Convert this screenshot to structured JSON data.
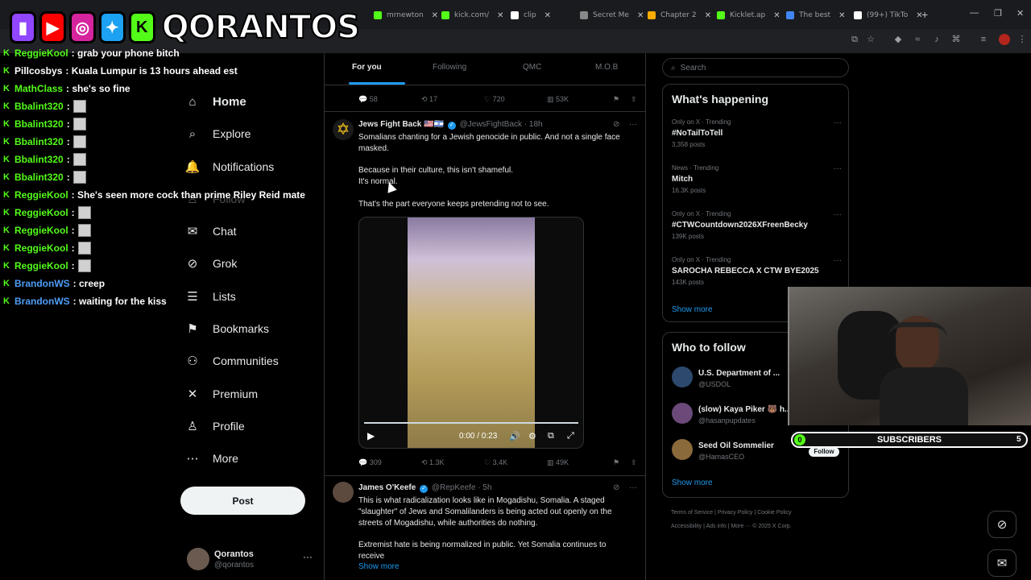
{
  "browser": {
    "tabs": [
      {
        "label": "mrnewton",
        "color": "#53fc18"
      },
      {
        "label": "kick.com/",
        "color": "#53fc18"
      },
      {
        "label": "clip",
        "color": "#ffffff"
      },
      {
        "label": "Secret Me",
        "color": "#888888"
      },
      {
        "label": "Chapter 2",
        "color": "#f9ab00"
      },
      {
        "label": "Kicklet.ap",
        "color": "#53fc18"
      },
      {
        "label": "The best",
        "color": "#4285f4"
      },
      {
        "label": "(99+) TikTo",
        "color": "#ffffff"
      }
    ]
  },
  "overlay": {
    "brand": "QORANTOS",
    "chat": [
      {
        "user": "ReggieKool",
        "color": "#53fc18",
        "text": ": grab your phone bitch",
        "emote": false
      },
      {
        "user": "Pillcosbys",
        "color": "#ffffff",
        "text": ": Kuala Lumpur is 13 hours ahead est",
        "emote": false
      },
      {
        "user": "MathClass",
        "color": "#53fc18",
        "text": ": she's so fine",
        "emote": false
      },
      {
        "user": "Bbalint320",
        "color": "#53fc18",
        "text": ":",
        "emote": true
      },
      {
        "user": "Bbalint320",
        "color": "#53fc18",
        "text": ":",
        "emote": true
      },
      {
        "user": "Bbalint320",
        "color": "#53fc18",
        "text": ":",
        "emote": true
      },
      {
        "user": "Bbalint320",
        "color": "#53fc18",
        "text": ":",
        "emote": true
      },
      {
        "user": "Bbalint320",
        "color": "#53fc18",
        "text": ":",
        "emote": true
      },
      {
        "user": "ReggieKool",
        "color": "#53fc18",
        "text": ": She's seen more cock than prime Riley Reid mate",
        "emote": false
      },
      {
        "user": "ReggieKool",
        "color": "#53fc18",
        "text": ":",
        "emote": true
      },
      {
        "user": "ReggieKool",
        "color": "#53fc18",
        "text": ":",
        "emote": true
      },
      {
        "user": "ReggieKool",
        "color": "#53fc18",
        "text": ":",
        "emote": true
      },
      {
        "user": "ReggieKool",
        "color": "#53fc18",
        "text": ":",
        "emote": true
      },
      {
        "user": "BrandonWS",
        "color": "#4f9ef8",
        "text": ": creep",
        "emote": false
      },
      {
        "user": "BrandonWS",
        "color": "#4f9ef8",
        "text": ": waiting for the kiss",
        "emote": false
      }
    ],
    "subscribers": {
      "label": "SUBSCRIBERS",
      "current": "0",
      "goal": "5",
      "progress": 0
    }
  },
  "nav": {
    "items": [
      {
        "label": "Home",
        "icon": "home-icon",
        "glyph": "⌂"
      },
      {
        "label": "Explore",
        "icon": "search-icon",
        "glyph": "⌕"
      },
      {
        "label": "Notifications",
        "icon": "bell-icon",
        "glyph": "🔔"
      },
      {
        "label": "Follow",
        "icon": "follow-icon",
        "glyph": "♙"
      },
      {
        "label": "Chat",
        "icon": "mail-icon",
        "glyph": "✉"
      },
      {
        "label": "Grok",
        "icon": "grok-icon",
        "glyph": "⊘"
      },
      {
        "label": "Lists",
        "icon": "list-icon",
        "glyph": "☰"
      },
      {
        "label": "Bookmarks",
        "icon": "bookmark-icon",
        "glyph": "⚑"
      },
      {
        "label": "Communities",
        "icon": "communities-icon",
        "glyph": "⚇"
      },
      {
        "label": "Premium",
        "icon": "x-logo-icon",
        "glyph": "✕"
      },
      {
        "label": "Profile",
        "icon": "profile-icon",
        "glyph": "♙"
      },
      {
        "label": "More",
        "icon": "more-circle-icon",
        "glyph": "⋯"
      }
    ],
    "post_label": "Post",
    "profile": {
      "name": "Qorantos",
      "handle": "@qorantos"
    }
  },
  "feed": {
    "tabs": [
      "For you",
      "Following",
      "QMC",
      "M.O.B"
    ],
    "prev_actions": {
      "replies": "58",
      "reposts": "17",
      "likes": "720",
      "views": "53K"
    },
    "tweet1": {
      "name": "Jews Fight Back 🇺🇸🇮🇱",
      "handle": "@JewsFightBack",
      "time": "· 18h",
      "line1": "Somalians chanting for a Jewish genocide in public. And not a single face masked.",
      "line2": "Because in their culture, this isn't shameful.",
      "line3": "It's normal.",
      "line4": "That's the part everyone keeps pretending not to see.",
      "video_time": "0:00 / 0:23",
      "actions": {
        "replies": "309",
        "reposts": "1.3K",
        "likes": "3.4K",
        "views": "49K"
      }
    },
    "tweet2": {
      "name": "James O'Keefe",
      "handle": "@RepKeefe",
      "time": "· 5h",
      "line1": "This is what radicalization looks like in Mogadishu, Somalia. A staged \"slaughter\" of Jews and Somalilanders is being acted out openly on the streets of Mogadishu, while authorities do nothing.",
      "line2": "Extremist hate is being normalized in public. Yet Somalia continues to receive",
      "show_more": "Show more"
    }
  },
  "sidebar": {
    "search_placeholder": "Search",
    "happening_title": "What's happening",
    "trends": [
      {
        "context": "Only on X · Trending",
        "name": "#NoTailToTell",
        "count": "3,358 posts"
      },
      {
        "context": "News · Trending",
        "name": "Mitch",
        "count": "16.3K posts"
      },
      {
        "context": "Only on X · Trending",
        "name": "#CTWCountdown2026XFreenBecky",
        "count": "139K posts"
      },
      {
        "context": "Only on X · Trending",
        "name": "SAROCHA REBECCA X CTW BYE2025",
        "count": "143K posts"
      }
    ],
    "show_more": "Show more",
    "wtf_title": "Who to follow",
    "wtf": [
      {
        "name": "U.S. Department of ...",
        "handle": "@USDOL"
      },
      {
        "name": "(slow) Kaya Piker 🐻 h...",
        "handle": "@hasanpupdates"
      },
      {
        "name": "Seed Oil Sommelier",
        "handle": "@HamasCEO"
      }
    ],
    "follow_label": "Follow",
    "wtf_show_more": "Show more",
    "footer1": "Terms of Service  |  Privacy Policy  |  Cookie Policy",
    "footer2": "Accessibility  |  Ads info  |  More ···  © 2025 X Corp."
  }
}
